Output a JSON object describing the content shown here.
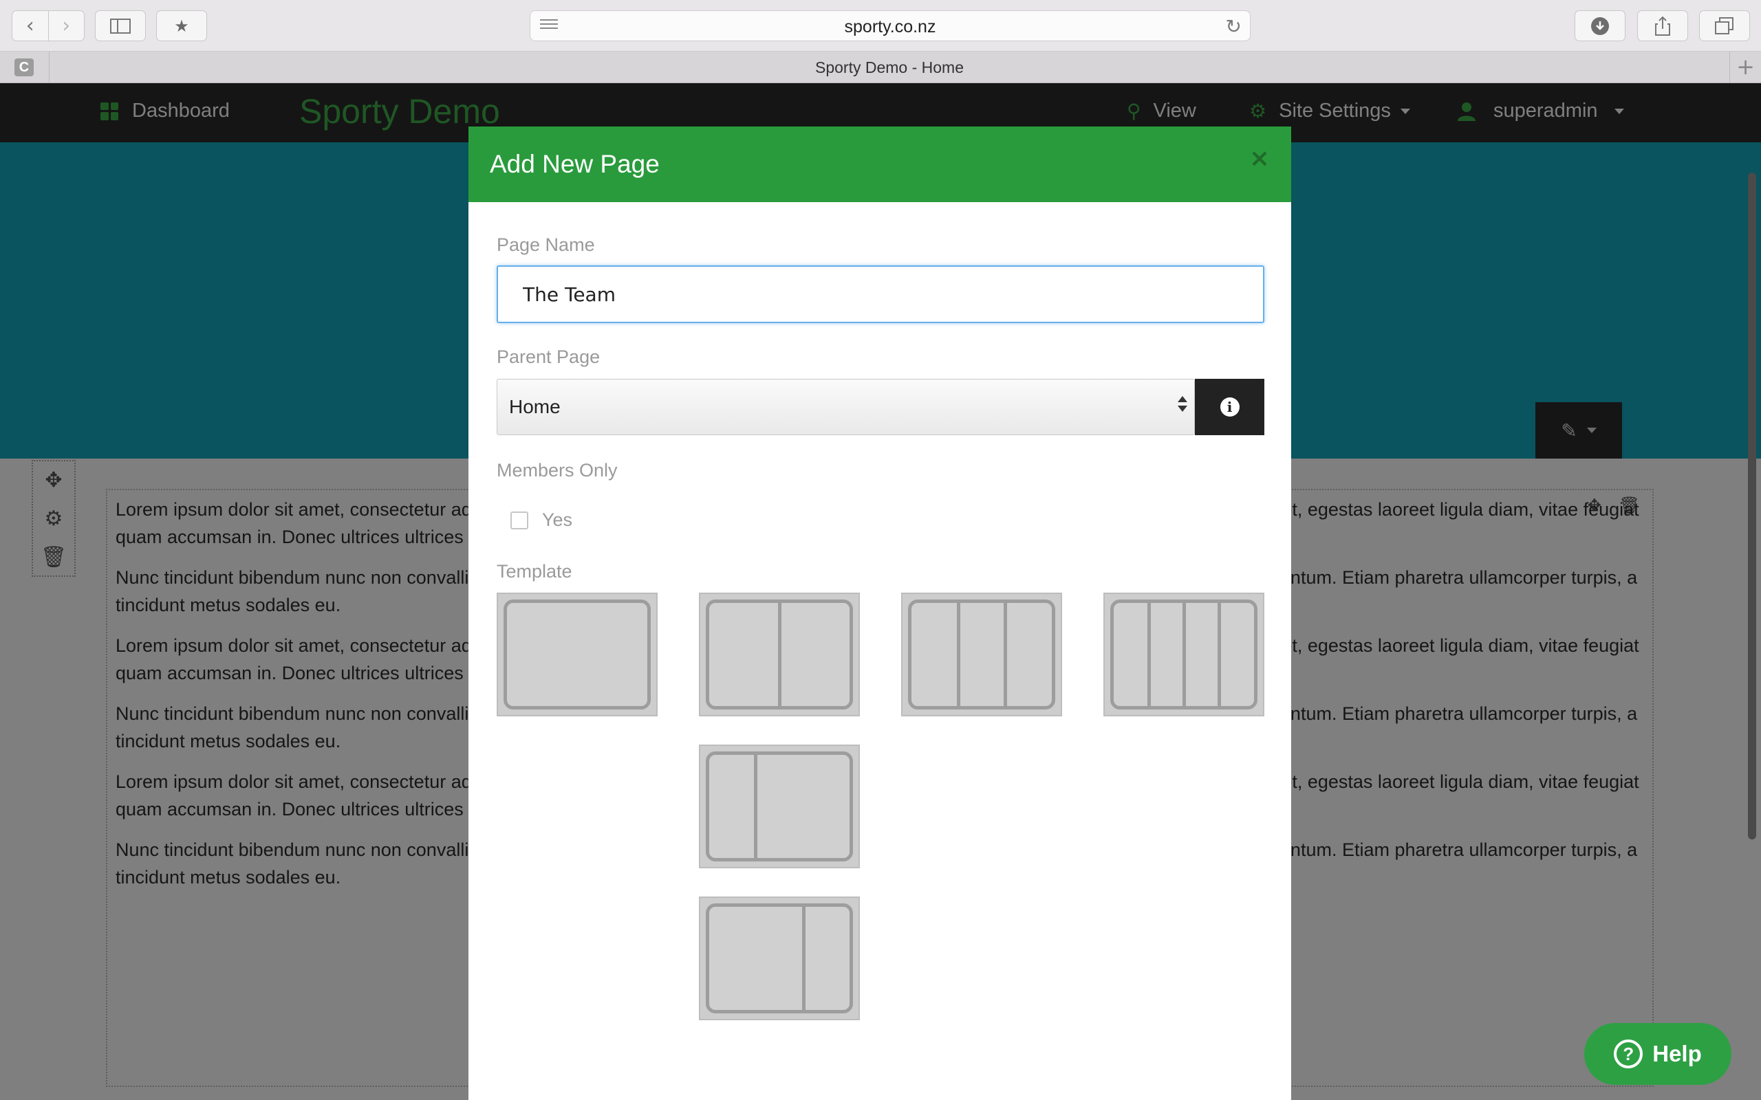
{
  "browser": {
    "url": "sporty.co.nz",
    "tab_title": "Sporty Demo - Home",
    "favicon_letter": "C",
    "new_tab": "+"
  },
  "site": {
    "nav": {
      "dashboard": "Dashboard",
      "brand": "Sporty Demo",
      "view": "View",
      "site_settings": "Site Settings",
      "user": "superadmin"
    },
    "paragraph_a_left": "Lorem ipsum dolor sit amet, consectetur adipiscing elit. Phasellus vehicula arcu ac, tempus augue. Vivamus tellus sem, tincidunt nec turpis eget, egestas laoreet ligula diam, vitae feugiat quam accumsan in. Donec ultrices ultrices fringilla.",
    "paragraph_b": "Nunc tincidunt bibendum nunc non convallis. Cras ac euismod tellus, quis sodales odio. In sodales consequat libero ac vestibulum. Nulla fermentum. Etiam pharetra ullamcorper turpis, a tincidunt metus sodales eu.",
    "help_label": "Help"
  },
  "modal": {
    "title": "Add New Page",
    "close": "×",
    "page_name_label": "Page Name",
    "page_name_value": "The Team",
    "parent_page_label": "Parent Page",
    "parent_page_value": "Home",
    "members_only_label": "Members Only",
    "members_only_option": "Yes",
    "members_only_checked": false,
    "template_label": "Template",
    "templates": [
      "single-column",
      "two-columns",
      "three-columns",
      "four-columns",
      "narrow-left-sidebar",
      "narrow-right-sidebar"
    ]
  },
  "colors": {
    "accent_green": "#299b3c",
    "hero_teal": "#12a8bd",
    "nav_dark": "#2b2b2b"
  }
}
